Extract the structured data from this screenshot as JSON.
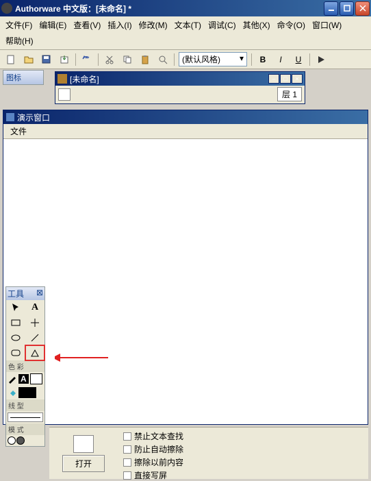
{
  "titlebar": {
    "title": "Authorware 中文版：[未命名] *"
  },
  "menu": {
    "file": "文件(F)",
    "edit": "编辑(E)",
    "view": "查看(V)",
    "insert": "插入(I)",
    "modify": "修改(M)",
    "text": "文本(T)",
    "debug": "调试(C)",
    "other": "其他(X)",
    "cmd": "命令(O)",
    "window": "窗口(W)",
    "help": "帮助(H)"
  },
  "toolbar": {
    "style_default": "(默认风格)"
  },
  "leftdock": {
    "header": "图标"
  },
  "docwin": {
    "title": "[未命名]",
    "layer_label": "层",
    "layer_value": "1"
  },
  "preswin": {
    "title": "演示窗口",
    "file_menu": "文件"
  },
  "toolpal": {
    "header": "工具",
    "close": "⊠",
    "color_section": "色 彩",
    "line_section": "线 型",
    "mode_section": "模 式"
  },
  "bottompane": {
    "open": "打开",
    "opt0": "禁止文本查找",
    "opt1": "防止自动擦除",
    "opt2": "擦除以前内容",
    "opt3": "直接写屏"
  }
}
